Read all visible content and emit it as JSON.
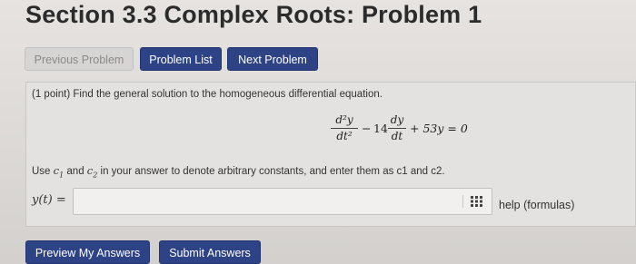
{
  "page": {
    "title": "Section 3.3 Complex Roots: Problem 1"
  },
  "nav": {
    "previous_label": "Previous Problem",
    "list_label": "Problem List",
    "next_label": "Next Problem"
  },
  "problem": {
    "statement": "(1 point) Find the general solution to the homogeneous differential equation.",
    "equation": {
      "term1_num": "d²y",
      "term1_den": "dt²",
      "minus": "−",
      "coef": "14",
      "term2_num": "dy",
      "term2_den": "dt",
      "rest": "+ 53y = 0"
    },
    "instructions": {
      "pre": "Use ",
      "c1_letter": "c",
      "c1_sub": "1",
      "and": " and ",
      "c2_letter": "c",
      "c2_sub": "2",
      "post": " in your answer to denote arbitrary constants, and enter them as c1 and c2."
    }
  },
  "answer": {
    "label": "y(t) =",
    "value": "",
    "help_label": "help (formulas)"
  },
  "actions": {
    "preview_label": "Preview My Answers",
    "submit_label": "Submit Answers"
  },
  "colors": {
    "primary_button": "#2d4385",
    "disabled_button": "#d6d5d3",
    "background": "#dcd9d6"
  },
  "icons": {
    "equation_editor": "keypad-grid-icon"
  }
}
